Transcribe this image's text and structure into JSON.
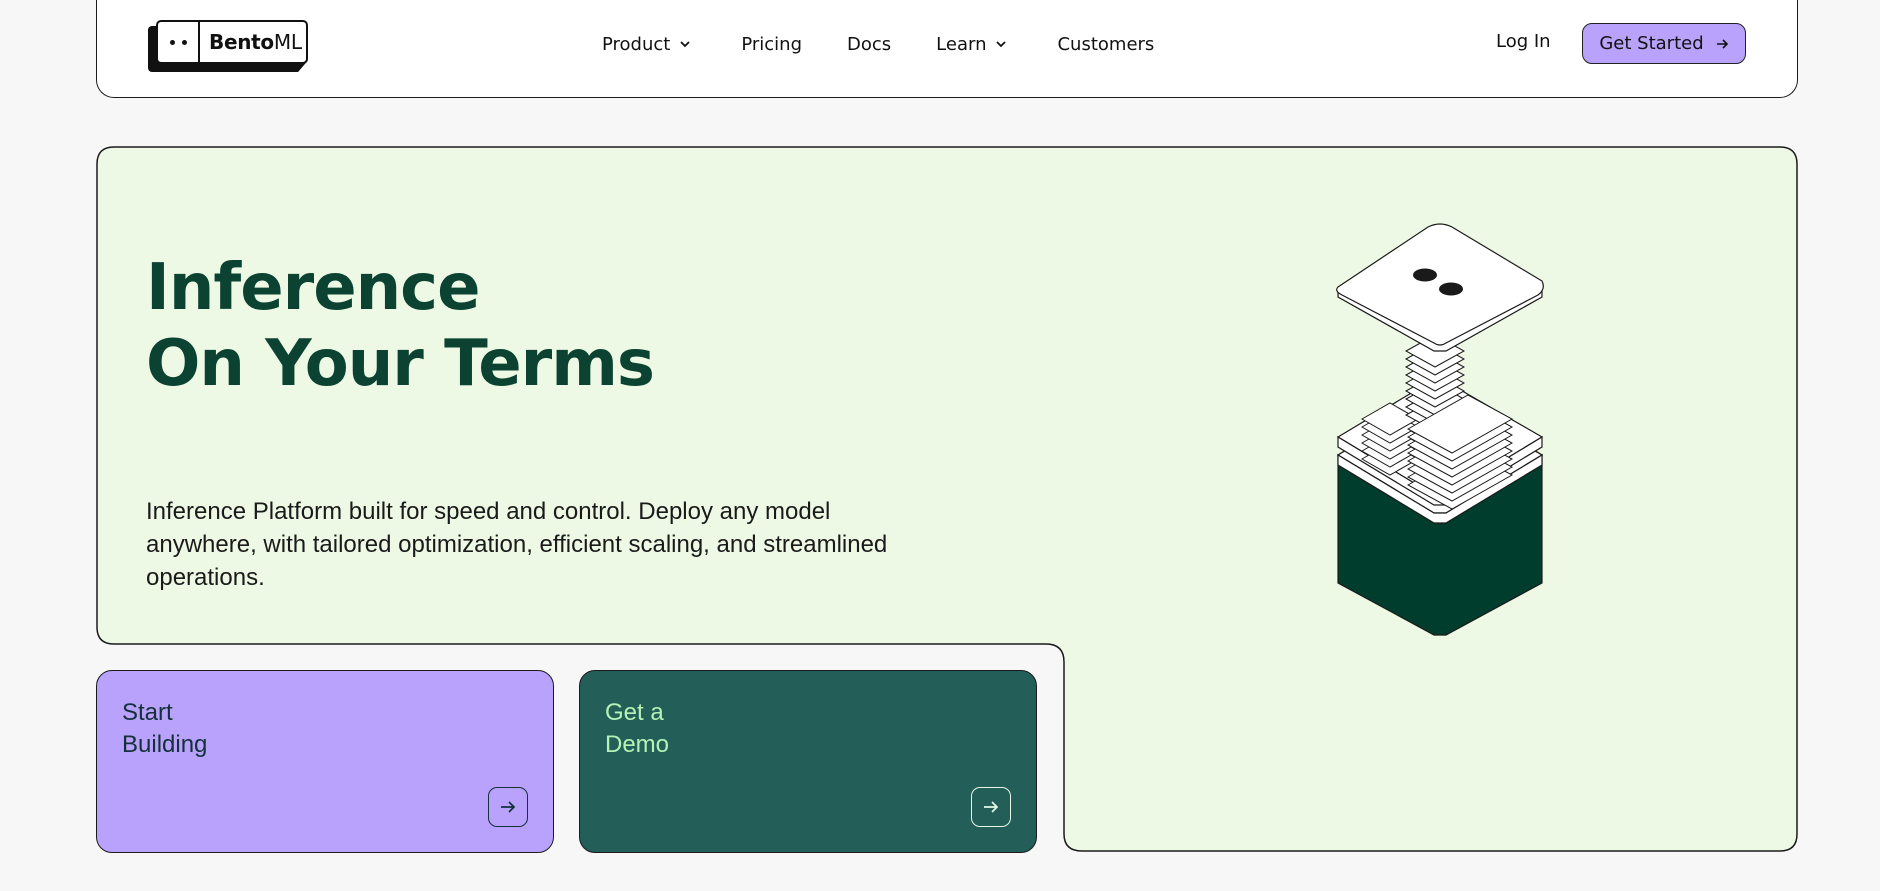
{
  "logo": {
    "bold": "Bento",
    "light": "ML"
  },
  "nav": {
    "items": [
      {
        "label": "Product",
        "dropdown": true
      },
      {
        "label": "Pricing",
        "dropdown": false
      },
      {
        "label": "Docs",
        "dropdown": false
      },
      {
        "label": "Learn",
        "dropdown": true
      },
      {
        "label": "Customers",
        "dropdown": false
      }
    ],
    "login": "Log In",
    "cta": "Get Started"
  },
  "hero": {
    "headline_line1": "Inference",
    "headline_line2": "On Your Terms",
    "description": "Inference Platform built for speed and control. Deploy any model anywhere, with tailored optimization, efficient scaling, and streamlined operations."
  },
  "cards": {
    "start_line1": "Start",
    "start_line2": "Building",
    "demo_line1": "Get a",
    "demo_line2": "Demo"
  },
  "colors": {
    "hero_bg": "#edf9e5",
    "headline": "#0b4232",
    "accent_purple": "#b8a2fb",
    "accent_green": "#235e58",
    "demo_text": "#b6f2b4"
  }
}
